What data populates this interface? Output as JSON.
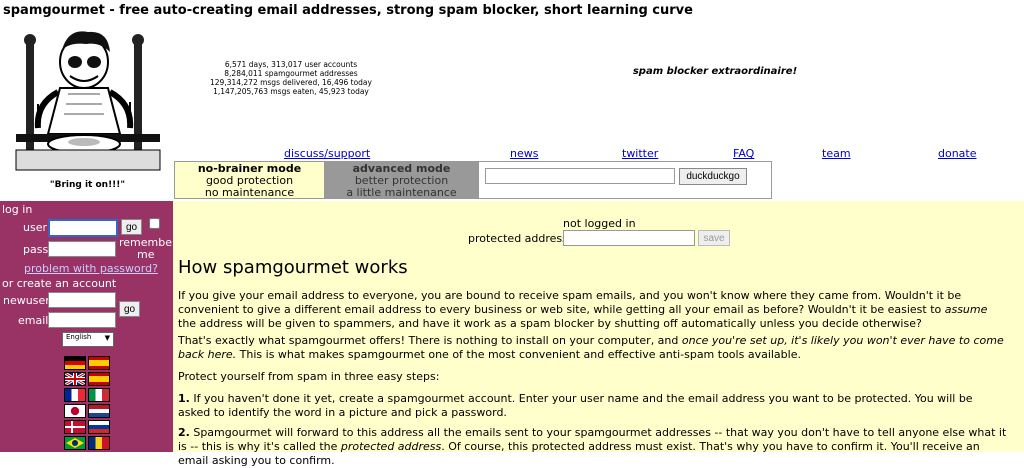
{
  "header": {
    "brand": "spamgourmet",
    "tagline": " - free auto-creating email addresses, strong spam blocker, short learning curve",
    "mascot_caption": "\"Bring it on!!!\"",
    "stats": [
      "6,571 days, 313,017 user accounts",
      "8,284,011 spamgourmet addresses",
      "129,314,272 msgs delivered, 16,496 today",
      "1,147,205,763 msgs eaten, 45,923 today"
    ],
    "slogan": "spam blocker extraordinaire!"
  },
  "nav": {
    "discuss": "discuss/support",
    "news": "news",
    "twitter": "twitter",
    "faq": "FAQ",
    "team": "team",
    "donate": "donate"
  },
  "modes": {
    "nobrainer": {
      "title": "no-brainer mode",
      "line1": "good protection",
      "line2": "no maintenance"
    },
    "advanced": {
      "title": "advanced mode",
      "line1": "better protection",
      "line2": "a little maintenance"
    }
  },
  "search": {
    "value": "",
    "button": "duckduckgo"
  },
  "sidebar": {
    "login_heading": "log in",
    "user_label": "user",
    "pass_label": "pass",
    "go1": "go",
    "remember1": "remember",
    "remember2": "me",
    "problem_link": "problem with password?",
    "create_heading": "or create an account",
    "newuser_label": "newuser",
    "email_label": "email",
    "go2": "go",
    "language": "English"
  },
  "main": {
    "login_status": "not logged in",
    "protected_label": "protected address",
    "protected_value": "",
    "save": "save",
    "heading": "How spamgourmet works",
    "p1a": "If you give your email address to everyone, you are bound to receive spam emails, and you won't know where they came from. Wouldn't it be convenient to give a different email address to every business or web site, while getting all your email as before? Wouldn't it be easiest to ",
    "p1em": "assume",
    "p1b": " the address will be given to spammers, and have it work as a spam blocker by shutting off automatically unless you decide otherwise?",
    "p2a": "That's exactly what spamgourmet offers! There is nothing to install on your computer, and ",
    "p2em": "once you're set up, it's likely you won't ever have to come back here.",
    "p2b": " This is what makes spamgourmet one of the most convenient and effective anti-spam tools available.",
    "p3": "Protect yourself from spam in three easy steps:",
    "s1num": "1.",
    "s1": " If you haven't done it yet, create a spamgourmet account. Enter your user name and the email address you want to be protected. You will be asked to identify the word in a picture and pick a password.",
    "s2num": "2.",
    "s2a": " Spamgourmet will forward to this address all the emails sent to your spamgourmet addresses -- that way you don't have to tell anyone else what it is -- this is why it's called the ",
    "s2em": "protected address",
    "s2b": ". Of course, this protected address must exist. That's why you have to confirm it. You'll receive an email asking you to confirm."
  },
  "colors": {
    "sidebar": "#993366",
    "main_bg": "#ffffcc",
    "link": "#0000cc"
  }
}
